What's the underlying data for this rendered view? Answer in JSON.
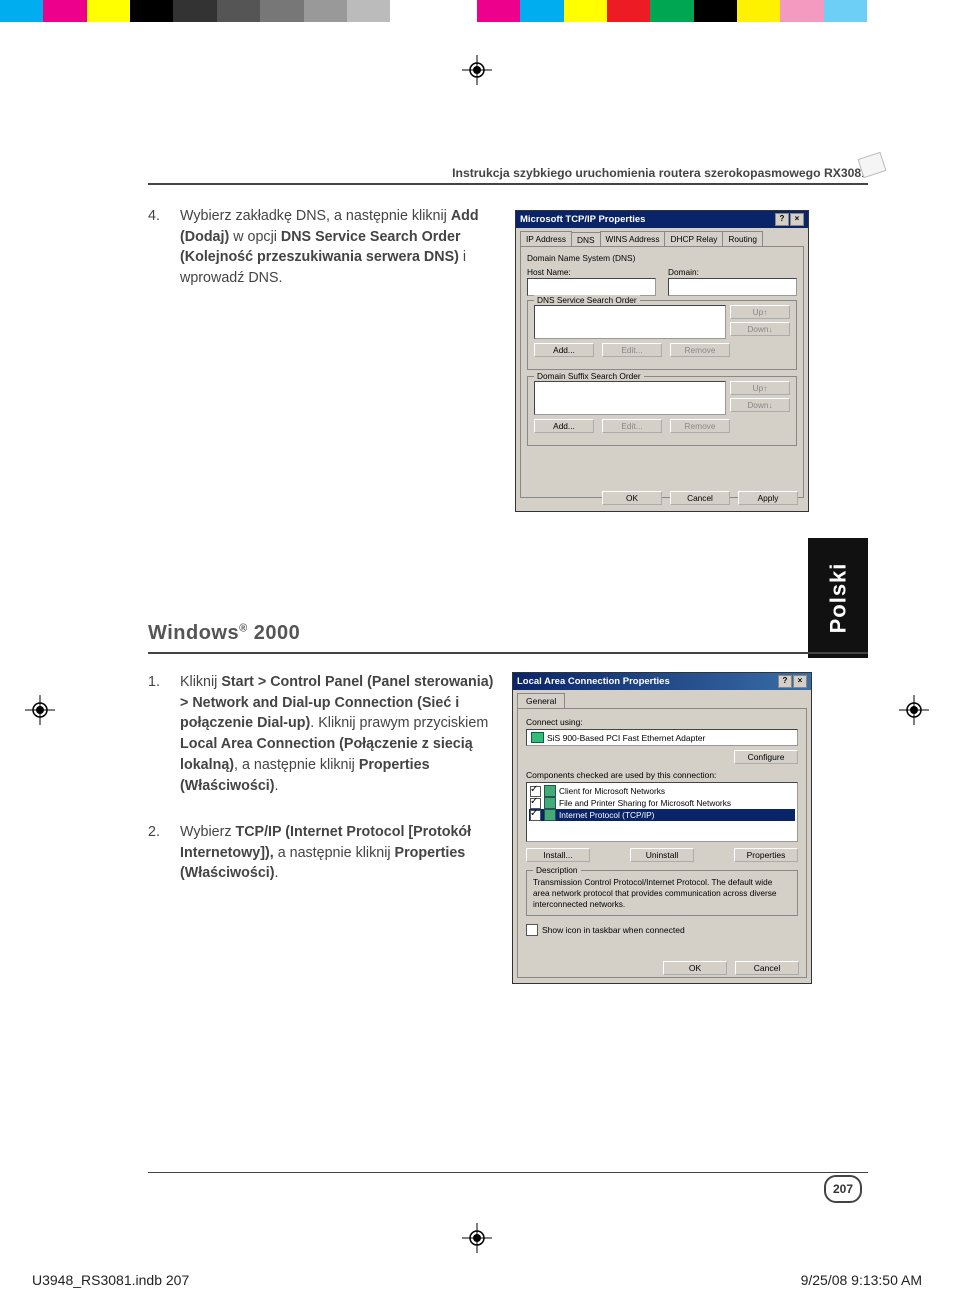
{
  "colorbar": [
    "#00aeef",
    "#ec008c",
    "#ffff00",
    "#000000",
    "#333333",
    "#555555",
    "#777777",
    "#999999",
    "#bbbbbb",
    "#ffffff",
    "#ffffff",
    "#ec008c",
    "#00aeef",
    "#ffff00",
    "#ed1c24",
    "#00a651",
    "#000000",
    "#fff200",
    "#f49ac1",
    "#6dcff6",
    "#6dcff6",
    "#fff"
  ],
  "header": "Instrukcja szybkiego uruchomienia routera szerokopasmowego RX3081",
  "step4": {
    "num": "4.",
    "pre": "Wybierz zakładkę DNS, a następnie kliknij ",
    "b1": "Add (Dodaj)",
    "mid1": " w opcji ",
    "b2": "DNS Service Search Order (Kolejność przeszukiwania serwera DNS)",
    "post": " i wprowadź DNS."
  },
  "h2_pre": "Windows",
  "h2_sup": "®",
  "h2_post": " 2000",
  "step1": {
    "num": "1.",
    "pre": "Kliknij ",
    "b1": "Start > Control Panel (Panel sterowania) > Network and Dial-up Connection (Sieć i połączenie Dial-up)",
    "mid1": ". Kliknij prawym przyciskiem ",
    "b2": "Local Area Connection (Połączenie z siecią lokalną)",
    "mid2": ", a następnie kliknij ",
    "b3": "Properties (Właściwości)",
    "post": "."
  },
  "step2": {
    "num": "2.",
    "pre": "Wybierz ",
    "b1": "TCP/IP (Internet Protocol [Protokół Internetowy]),",
    "mid": " a następnie kliknij ",
    "b2": "Properties (Właściwości)",
    "post": "."
  },
  "langtab": "Polski",
  "pagenum": "207",
  "footL": "U3948_RS3081.indb   207",
  "footR": "9/25/08   9:13:50 AM",
  "dlg1": {
    "title": "Microsoft TCP/IP Properties",
    "tabs": [
      "IP Address",
      "DNS",
      "WINS Address",
      "DHCP Relay",
      "Routing"
    ],
    "tab_active": "DNS",
    "grp_dns": "Domain Name System (DNS)",
    "hostname": "Host Name:",
    "domain": "Domain:",
    "grp_svc": "DNS Service Search Order",
    "grp_sfx": "Domain Suffix Search Order",
    "btn_up": "Up↑",
    "btn_down": "Down↓",
    "btn_add": "Add...",
    "btn_edit": "Edit...",
    "btn_remove": "Remove",
    "btn_ok": "OK",
    "btn_cancel": "Cancel",
    "btn_apply": "Apply"
  },
  "dlg2": {
    "title": "Local Area Connection Properties",
    "tab": "General",
    "connect_using": "Connect using:",
    "adapter": "SiS 900-Based PCI Fast Ethernet Adapter",
    "configure": "Configure",
    "comp_label": "Components checked are used by this connection:",
    "items": [
      "Client for Microsoft Networks",
      "File and Printer Sharing for Microsoft Networks",
      "Internet Protocol (TCP/IP)"
    ],
    "install": "Install...",
    "uninstall": "Uninstall",
    "properties": "Properties",
    "desc_label": "Description",
    "desc": "Transmission Control Protocol/Internet Protocol. The default wide area network protocol that provides communication across diverse interconnected networks.",
    "show_icon": "Show icon in taskbar when connected",
    "ok": "OK",
    "cancel": "Cancel"
  }
}
